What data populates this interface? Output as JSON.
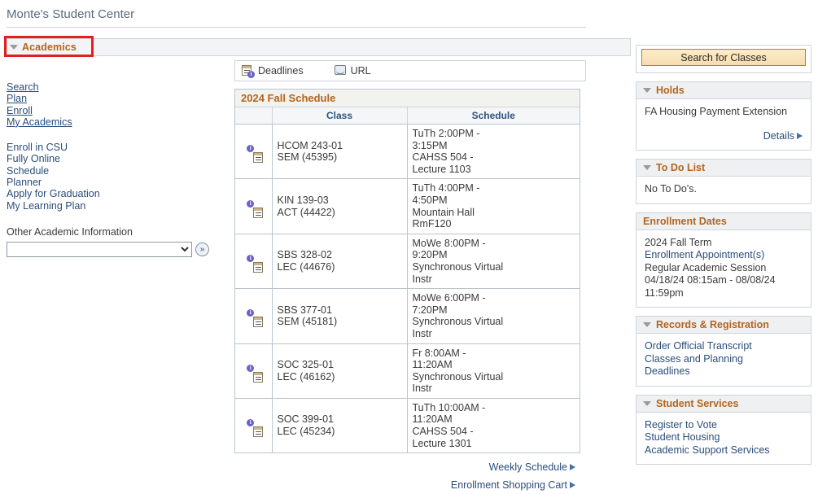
{
  "page": {
    "title": "Monte's Student Center"
  },
  "academics": {
    "header_label": "Academics",
    "links_primary": [
      {
        "label": "Search"
      },
      {
        "label": "Plan"
      },
      {
        "label": "Enroll"
      },
      {
        "label": "My Academics"
      }
    ],
    "links_secondary": [
      {
        "label": "Enroll in CSU"
      },
      {
        "label": "Fully Online"
      },
      {
        "label": "Schedule"
      },
      {
        "label": "Planner"
      },
      {
        "label": "Apply for Graduation"
      },
      {
        "label": "My Learning Plan"
      }
    ],
    "other_info_label": "Other Academic Information",
    "other_info_value": "",
    "go_button_label": "»"
  },
  "legend": {
    "deadlines_label": "Deadlines",
    "deadlines_icon": "calendar-info-icon",
    "url_label": "URL",
    "url_icon": "url-globe-icon"
  },
  "schedule": {
    "title": "2024 Fall Schedule",
    "columns": [
      "",
      "Class",
      "Schedule"
    ],
    "rows": [
      {
        "icon": "calendar-info-icon",
        "class_lines": [
          "HCOM 243-01",
          "SEM (45395)"
        ],
        "schedule_lines": [
          "TuTh 2:00PM -",
          "3:15PM",
          "CAHSS 504 -",
          "Lecture 1103"
        ]
      },
      {
        "icon": "calendar-info-icon",
        "class_lines": [
          "KIN 139-03",
          "ACT (44422)"
        ],
        "schedule_lines": [
          "TuTh 4:00PM -",
          "4:50PM",
          "Mountain Hall",
          "RmF120"
        ]
      },
      {
        "icon": "calendar-info-icon",
        "class_lines": [
          "SBS 328-02",
          "LEC (44676)"
        ],
        "schedule_lines": [
          "MoWe 8:00PM -",
          "9:20PM",
          "Synchronous Virtual",
          "Instr"
        ]
      },
      {
        "icon": "calendar-info-icon",
        "class_lines": [
          "SBS 377-01",
          "SEM (45181)"
        ],
        "schedule_lines": [
          "MoWe 6:00PM -",
          "7:20PM",
          "Synchronous Virtual",
          "Instr"
        ]
      },
      {
        "icon": "calendar-info-icon",
        "class_lines": [
          "SOC 325-01",
          "LEC (46162)"
        ],
        "schedule_lines": [
          "Fr 8:00AM -",
          "11:20AM",
          "Synchronous Virtual",
          "Instr"
        ]
      },
      {
        "icon": "calendar-info-icon",
        "class_lines": [
          "SOC 399-01",
          "LEC (45234)"
        ],
        "schedule_lines": [
          "TuTh 10:00AM -",
          "11:20AM",
          "CAHSS 504 -",
          "Lecture 1301"
        ]
      }
    ],
    "footer_links": [
      {
        "label": "Weekly Schedule"
      },
      {
        "label": "Enrollment Shopping Cart"
      }
    ]
  },
  "right": {
    "search_button_label": "Search for Classes",
    "holds": {
      "header": "Holds",
      "items": [
        "FA Housing Payment Extension"
      ],
      "details_label": "Details"
    },
    "todo": {
      "header": "To Do List",
      "empty_text": "No To Do's."
    },
    "enrollment_dates": {
      "header": "Enrollment Dates",
      "term": "2024 Fall Term",
      "appointments_link": "Enrollment Appointment(s)",
      "session": "Regular Academic Session",
      "window_line1": "04/18/24 08:15am - 08/08/24",
      "window_line2": "11:59pm"
    },
    "records": {
      "header": "Records & Registration",
      "links": [
        "Order Official Transcript",
        "Classes and Planning",
        "Deadlines"
      ]
    },
    "student_services": {
      "header": "Student Services",
      "links": [
        "Register to Vote",
        "Student Housing",
        "Academic Support Services"
      ]
    }
  },
  "colors": {
    "accent_orange": "#b5651d",
    "link_blue": "#2a4d7a",
    "annotation_red": "#e02020",
    "panel_header_bg": "#eef0f2",
    "button_gold": "#f7dcae"
  }
}
